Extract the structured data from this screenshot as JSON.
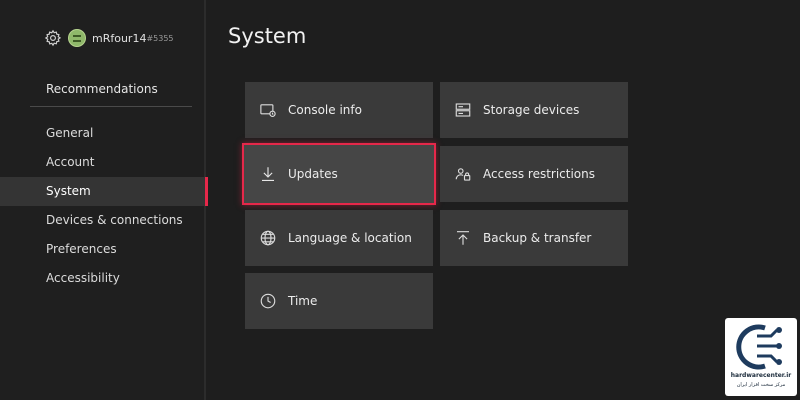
{
  "profile": {
    "gamertag": "mRfour14",
    "suffix": "#5355"
  },
  "sidebar": {
    "recommendations": "Recommendations",
    "items": [
      {
        "label": "General"
      },
      {
        "label": "Account"
      },
      {
        "label": "System",
        "selected": true
      },
      {
        "label": "Devices & connections"
      },
      {
        "label": "Preferences"
      },
      {
        "label": "Accessibility"
      }
    ]
  },
  "main": {
    "title": "System",
    "tiles": [
      {
        "label": "Console info",
        "icon": "console-info-icon"
      },
      {
        "label": "Storage devices",
        "icon": "storage-icon"
      },
      {
        "label": "Updates",
        "icon": "download-icon",
        "focused": true
      },
      {
        "label": "Access restrictions",
        "icon": "access-restrictions-icon"
      },
      {
        "label": "Language & location",
        "icon": "globe-icon"
      },
      {
        "label": "Backup & transfer",
        "icon": "upload-icon"
      },
      {
        "label": "Time",
        "icon": "clock-icon"
      }
    ]
  },
  "watermark": {
    "site": "hardwarecenter.ir",
    "subtitle": "مرکز سخت افزار ایران"
  },
  "colors": {
    "accent": "#e6284a",
    "tile": "#3a3a3a",
    "background": "#1e1e1e"
  }
}
